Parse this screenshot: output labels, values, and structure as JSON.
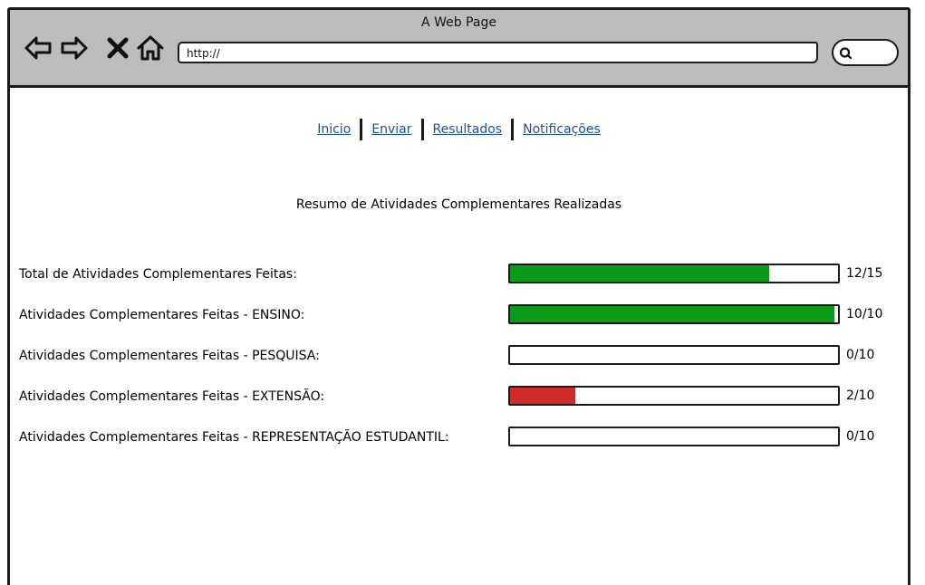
{
  "browser": {
    "title": "A Web Page",
    "address": "http://"
  },
  "menu": {
    "items": [
      "Inicio",
      "Enviar",
      "Resultados",
      "Notificações"
    ]
  },
  "heading": "Resumo de Atividades Complementares Realizadas",
  "colors": {
    "green": "#0a9a1a",
    "red": "#d02a2a"
  },
  "rows": [
    {
      "label": "Total de Atividades Complementares Feitas:",
      "value": "12/15",
      "fraction": 0.79,
      "color": "#0a9a1a"
    },
    {
      "label": "Atividades Complementares Feitas - ENSINO:",
      "value": "10/10",
      "fraction": 0.99,
      "color": "#0a9a1a"
    },
    {
      "label": "Atividades Complementares Feitas - PESQUISA:",
      "value": "0/10",
      "fraction": 0,
      "color": "#0a9a1a"
    },
    {
      "label": "Atividades Complementares Feitas - EXTENSÃO:",
      "value": "2/10",
      "fraction": 0.2,
      "color": "#d02a2a"
    },
    {
      "label": "Atividades Complementares Feitas - REPRESENTAÇÃO ESTUDANTIL:",
      "value": "0/10",
      "fraction": 0,
      "color": "#0a9a1a"
    }
  ]
}
